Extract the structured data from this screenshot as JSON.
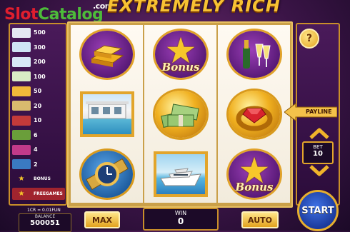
{
  "header": {
    "logo_slot": "Slot",
    "logo_catalog": "Catalog",
    "logo_com": ".com",
    "game_title": "EXTREMELY RICH"
  },
  "paytable": [
    {
      "value": "500",
      "icon": "bills-stack-icon",
      "color": "#e4e9f3"
    },
    {
      "value": "300",
      "icon": "house-icon",
      "color": "#cfe5f5"
    },
    {
      "value": "200",
      "icon": "yacht-icon",
      "color": "#d7e8f6"
    },
    {
      "value": "100",
      "icon": "cash-bundle-icon",
      "color": "#d9ecc5"
    },
    {
      "value": "50",
      "icon": "gold-bars-icon",
      "color": "#f1b83a"
    },
    {
      "value": "20",
      "icon": "watch-icon",
      "color": "#d8ba6e"
    },
    {
      "value": "10",
      "icon": "ring-icon",
      "color": "#c43a3a"
    },
    {
      "value": "6",
      "icon": "champagne-icon",
      "color": "#6a9e3a"
    },
    {
      "value": "4",
      "icon": "letter-a-icon",
      "color": "#c23a8a"
    },
    {
      "value": "2",
      "icon": "letter-k-icon",
      "color": "#3a7ac2"
    },
    {
      "value": "BONUS",
      "icon": "star-bonus-icon",
      "color": "#f7c72a"
    },
    {
      "value": "FREEGAMES",
      "icon": "freegames-icon",
      "color": "#f7c72a"
    }
  ],
  "reels": {
    "reel1": [
      "gold-bars-icon",
      "house-icon",
      "watch-icon"
    ],
    "reel2": [
      "star-bonus-icon",
      "cash-bundle-icon",
      "yacht-icon"
    ],
    "reel3": [
      "champagne-icon",
      "ring-icon",
      "star-bonus-icon"
    ],
    "bonus_label": "Bonus"
  },
  "controls": {
    "help_label": "?",
    "payline_label": "PAYLINE",
    "bet_label": "BET",
    "bet_value": "10",
    "start_label": "START",
    "max_label": "MAX",
    "auto_label": "AUTO",
    "win_label": "WIN",
    "win_value": "0",
    "credit_info": "1CR = 0.01FUN",
    "balance_label": "BALANCE",
    "balance_value": "500051"
  },
  "colors": {
    "frame_gold": "#e2a52b",
    "background_purple": "#3a1446",
    "start_blue": "#1b3a9c"
  }
}
